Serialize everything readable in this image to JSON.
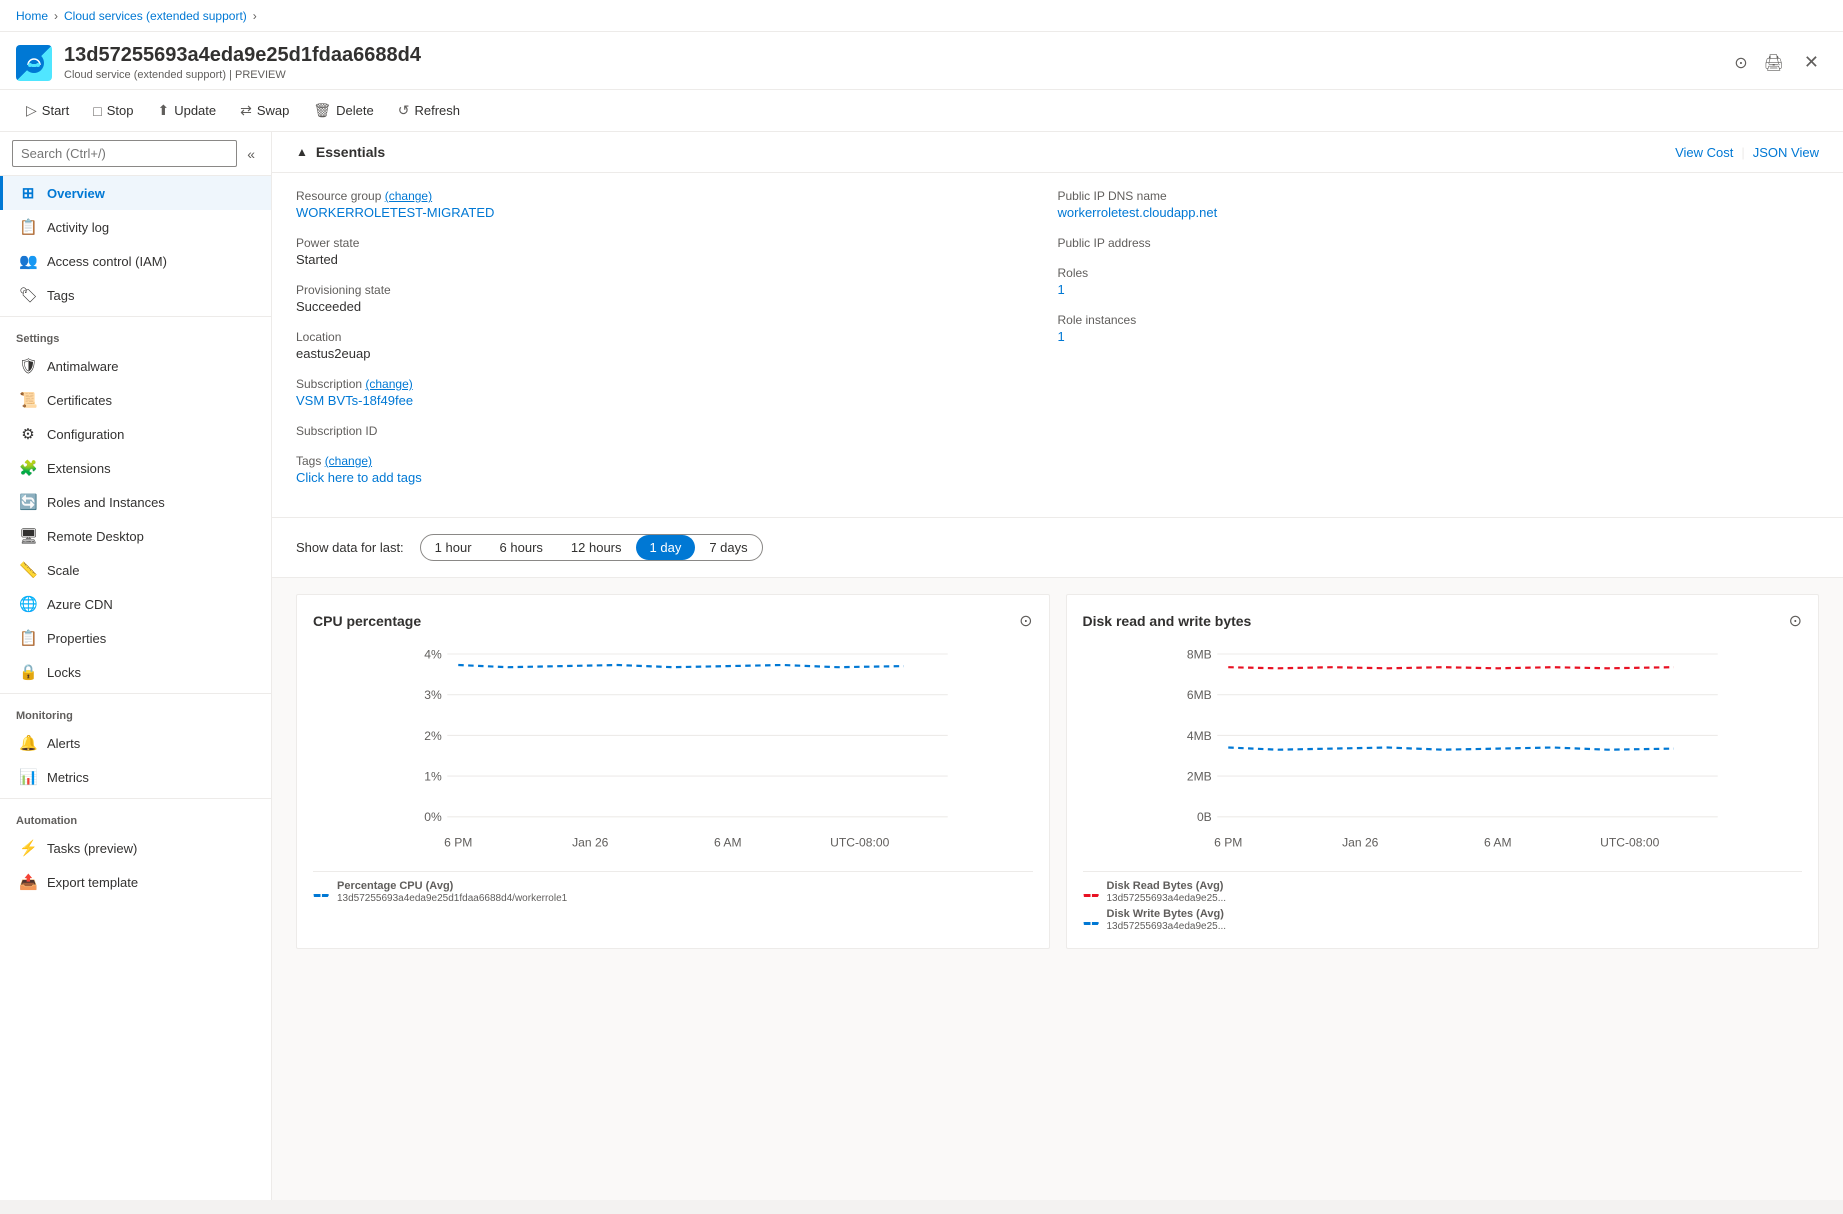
{
  "breadcrumb": {
    "home": "Home",
    "separator1": ">",
    "cloud_services": "Cloud services (extended support)",
    "separator2": ">"
  },
  "page": {
    "title": "13d57255693a4eda9e25d1fdaa6688d4",
    "subtitle": "Cloud service (extended support) | PREVIEW",
    "icon": "☁"
  },
  "toolbar": {
    "start": "Start",
    "stop": "Stop",
    "update": "Update",
    "swap": "Swap",
    "delete": "Delete",
    "refresh": "Refresh"
  },
  "sidebar": {
    "search_placeholder": "Search (Ctrl+/)",
    "nav_items": [
      {
        "label": "Overview",
        "icon": "⊞",
        "active": true
      },
      {
        "label": "Activity log",
        "icon": "📋"
      },
      {
        "label": "Access control (IAM)",
        "icon": "👥"
      },
      {
        "label": "Tags",
        "icon": "🏷"
      }
    ],
    "settings_label": "Settings",
    "settings_items": [
      {
        "label": "Antimalware",
        "icon": "🛡"
      },
      {
        "label": "Certificates",
        "icon": "📜"
      },
      {
        "label": "Configuration",
        "icon": "⚙"
      },
      {
        "label": "Extensions",
        "icon": "🧩"
      },
      {
        "label": "Roles and Instances",
        "icon": "🔄"
      },
      {
        "label": "Remote Desktop",
        "icon": "🖥"
      },
      {
        "label": "Scale",
        "icon": "📏"
      },
      {
        "label": "Azure CDN",
        "icon": "🌐"
      },
      {
        "label": "Properties",
        "icon": "📋"
      },
      {
        "label": "Locks",
        "icon": "🔒"
      }
    ],
    "monitoring_label": "Monitoring",
    "monitoring_items": [
      {
        "label": "Alerts",
        "icon": "🔔"
      },
      {
        "label": "Metrics",
        "icon": "📊"
      }
    ],
    "automation_label": "Automation",
    "automation_items": [
      {
        "label": "Tasks (preview)",
        "icon": "⚡"
      },
      {
        "label": "Export template",
        "icon": "📤"
      }
    ]
  },
  "essentials": {
    "title": "Essentials",
    "view_cost": "View Cost",
    "json_view": "JSON View",
    "fields": [
      {
        "label": "Resource group",
        "value": "WORKERROLETEST-MIGRATED",
        "change": true,
        "link": true
      },
      {
        "label": "Public IP DNS name",
        "value": "workerroletest.cloudapp.net",
        "link": true
      },
      {
        "label": "Power state",
        "value": "Started",
        "link": false
      },
      {
        "label": "Public IP address",
        "value": "",
        "link": false
      },
      {
        "label": "Provisioning state",
        "value": "Succeeded",
        "link": false
      },
      {
        "label": "Roles",
        "value": "1",
        "link": true
      },
      {
        "label": "Location",
        "value": "eastus2euap",
        "link": false
      },
      {
        "label": "Role instances",
        "value": "1",
        "link": true
      },
      {
        "label": "Subscription",
        "value": "VSM BVTs-18f49fee",
        "change": true,
        "link": true
      },
      {
        "label": "",
        "value": "",
        "link": false
      },
      {
        "label": "Subscription ID",
        "value": "",
        "link": false
      },
      {
        "label": "",
        "value": "",
        "link": false
      },
      {
        "label": "Tags",
        "value": "Click here to add tags",
        "change": true,
        "link": true
      }
    ]
  },
  "time_selector": {
    "label": "Show data for last:",
    "options": [
      {
        "label": "1 hour",
        "active": false
      },
      {
        "label": "6 hours",
        "active": false
      },
      {
        "label": "12 hours",
        "active": false
      },
      {
        "label": "1 day",
        "active": true
      },
      {
        "label": "7 days",
        "active": false
      }
    ]
  },
  "charts": [
    {
      "id": "cpu",
      "title": "CPU percentage",
      "y_labels": [
        "4%",
        "3%",
        "2%",
        "1%",
        "0%"
      ],
      "x_labels": [
        "6 PM",
        "Jan 26",
        "6 AM",
        "UTC-08:00"
      ],
      "legend": [
        {
          "color": "#0078d4",
          "label": "Percentage CPU (Avg)",
          "sublabel": "13d57255693a4eda9e25d1fdaa6688d4/workerrole1",
          "dashed": true
        }
      ]
    },
    {
      "id": "disk",
      "title": "Disk read and write bytes",
      "y_labels": [
        "8MB",
        "6MB",
        "4MB",
        "2MB",
        "0B"
      ],
      "x_labels": [
        "6 PM",
        "Jan 26",
        "6 AM",
        "UTC-08:00"
      ],
      "legend": [
        {
          "color": "#e81123",
          "label": "Disk Read Bytes (Avg)",
          "sublabel": "13d57255693a4eda9e25...",
          "dashed": true
        },
        {
          "color": "#0078d4",
          "label": "Disk Write Bytes (Avg)",
          "sublabel": "13d57255693a4eda9e25...",
          "dashed": true
        }
      ]
    }
  ]
}
